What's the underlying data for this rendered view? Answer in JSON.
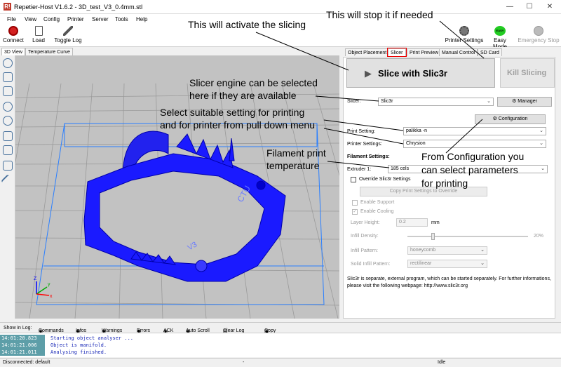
{
  "window": {
    "title": "Repetier-Host V1.6.2 - 3D_test_V3_0.4mm.stl",
    "app_icon": "R!",
    "min": "—",
    "max": "☐",
    "close": "✕"
  },
  "menu": [
    "File",
    "View",
    "Config",
    "Printer",
    "Server",
    "Tools",
    "Help"
  ],
  "toolbar": {
    "connect": "Connect",
    "load": "Load",
    "toggle_log": "Toggle Log",
    "printer_settings": "Printer Settings",
    "easy_mode": "Easy Mode",
    "easy_icon": "EASY",
    "emergency_stop": "Emergency Stop"
  },
  "left_tabs": [
    "3D View",
    "Temperature Curve"
  ],
  "right_tabs": [
    "Object Placement",
    "Slicer",
    "Print Preview",
    "Manual Control",
    "SD Card"
  ],
  "slicer": {
    "slice_button": "Slice with Slic3r",
    "kill_button": "Kill Slicing",
    "slicer_label": "Slicer:",
    "slicer_value": "Slic3r",
    "manager_button": "Manager",
    "configuration_button": "Configuration",
    "print_setting_label": "Print Setting:",
    "print_setting_value": "palikka -n",
    "printer_settings_label": "Printer Settings:",
    "printer_settings_value": "Chrysion",
    "filament_settings_label": "Filament Settings:",
    "extruder_label": "Extruder 1:",
    "extruder_value": "185 cels",
    "override_label": "Override Slic3r Settings",
    "copy_button": "Copy Print Settings to Override",
    "enable_support": "Enable Support",
    "enable_cooling": "Enable Cooling",
    "layer_height_label": "Layer Height:",
    "layer_height_value": "0.2",
    "layer_height_unit": "mm",
    "infill_density_label": "Infill Density:",
    "infill_density_value": "20%",
    "infill_density_fraction": 0.2,
    "infill_pattern_label": "Infill Pattern:",
    "infill_pattern_value": "honeycomb",
    "solid_infill_label": "Solid Infill Pattern:",
    "solid_infill_value": "rectilinear",
    "info_line1": "Slic3r is separate, external program, which can be started separately. For further informations,",
    "info_line2": "please visit the following webpage: http://www.slic3r.org"
  },
  "annotations": {
    "stop": "This will stop it if needed",
    "activate": "This will activate the slicing",
    "engine1": "Slicer engine can be selected",
    "engine2": "here if they are available",
    "select1": "Select suitable setting for printing",
    "select2": "and for printer from pull down menu",
    "filament1": "Filament print",
    "filament2": "temperature",
    "config1": "From Configuration you",
    "config2": "can select parameters",
    "config3": "for printing"
  },
  "log": {
    "show_in_log": "Show in Log:",
    "filters": [
      "Commands",
      "Infos",
      "Warnings",
      "Errors",
      "ACK",
      "Auto Scroll",
      "Clear Log",
      "Copy"
    ],
    "rows": [
      {
        "time": "14:01:20.823",
        "msg": "Starting object analyser ..."
      },
      {
        "time": "14:01:21.006",
        "msg": "Object is manifold."
      },
      {
        "time": "14:01:21.011",
        "msg": "Analysing finished."
      }
    ]
  },
  "status": {
    "left": "Disconnected: default",
    "middle": "-",
    "right": "Idle"
  },
  "model": {
    "label_v3": "V3",
    "label_ctu": "CTU",
    "axis_z": "Z",
    "axis_y": "y",
    "axis_x": "x"
  },
  "colors": {
    "model": "#1a1aff",
    "log_time_bg": "#5d9ea8",
    "highlight": "#e00000"
  }
}
